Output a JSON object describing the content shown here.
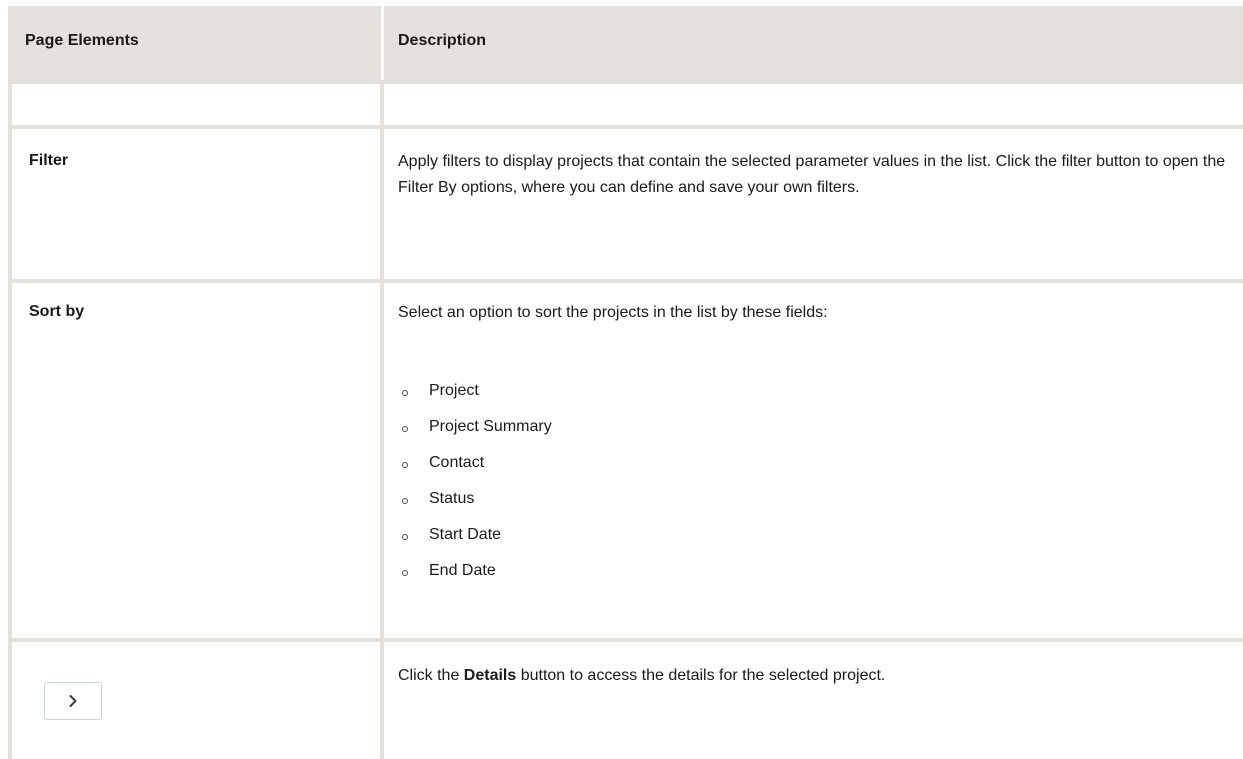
{
  "table": {
    "headers": {
      "left": "Page Elements",
      "right": "Description"
    },
    "rows": {
      "filter": {
        "term": "Filter",
        "description": "Apply filters to display projects that contain the selected parameter values in the list. Click the filter button to open the Filter By options, where you can define and save your own filters."
      },
      "sort_by": {
        "term": "Sort by",
        "description": "Select an option to sort the projects in the list by these fields:",
        "options": [
          "Project",
          "Project Summary",
          "Contact",
          "Status",
          "Start Date",
          "End Date"
        ]
      },
      "details": {
        "icon": "chevron-right-icon",
        "desc_before": "Click the ",
        "desc_bold": "Details",
        "desc_after": " button to access the details for the selected project."
      }
    }
  }
}
